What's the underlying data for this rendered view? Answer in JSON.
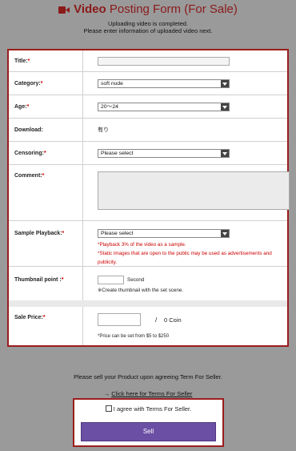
{
  "header": {
    "title_strong": "Video",
    "title_rest": "Posting Form (For Sale)",
    "message_line1": "Uploading video is completed.",
    "message_line2": "Please enter information of uploaded video next."
  },
  "form": {
    "title": {
      "label": "Title:",
      "req": "*",
      "value": ""
    },
    "category": {
      "label": "Category:",
      "req": "*",
      "selected": "soft nude"
    },
    "age": {
      "label": "Age:",
      "req": "*",
      "selected": "20～24"
    },
    "download": {
      "label": "Download:",
      "value": "有り"
    },
    "censoring": {
      "label": "Censoring:",
      "req": "*",
      "selected": "Please select"
    },
    "comment": {
      "label": "Comment:",
      "req": "*",
      "value": ""
    },
    "sample_playback": {
      "label": "Sample Playback:",
      "req": "*",
      "selected": "Please select",
      "note1": "*Playback 3% of the video as a sample.",
      "note2": "*Static images that are open to the public may be used as advertisements and publicity."
    },
    "thumbnail": {
      "label": "Thumbnail point :",
      "req": "*",
      "value": "",
      "unit": "Second",
      "note": "※Create thumbnail with the set scene."
    },
    "sale_price": {
      "label": "Sale Price:",
      "req": "*",
      "value": "",
      "slash": "/",
      "coin_text": "0 Coin",
      "note": "*Price can be set from $5 to $250"
    }
  },
  "footer": {
    "sell_message": "Please sell your Product upon agreeing Term For Seller.",
    "terms_arrow": "→",
    "terms_link": "Click here for Terms For Seller",
    "agree_label": "I agree with Terms For Seller.",
    "sell_button": "Sell"
  },
  "colors": {
    "accent_red": "#9b1c1c",
    "required_red": "#cc0000",
    "sell_button": "#6b4fa4",
    "page_bg": "#9a9a9a"
  }
}
